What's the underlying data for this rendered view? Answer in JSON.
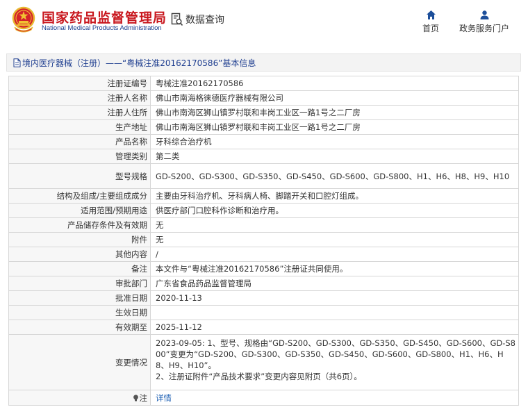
{
  "header": {
    "brand_cn": "国家药品监督管理局",
    "brand_en": "National Medical Products Administration",
    "query_label": "数据查询",
    "nav": [
      {
        "label": "首页",
        "icon": "home-icon"
      },
      {
        "label": "政务服务门户",
        "icon": "user-icon"
      }
    ]
  },
  "title_bar": {
    "text": "境内医疗器械（注册）——“粤械注准20162170586”基本信息"
  },
  "fields": [
    {
      "label": "注册证编号",
      "value": "粤械注准20162170586"
    },
    {
      "label": "注册人名称",
      "value": "佛山市南海格徕德医疗器械有限公司"
    },
    {
      "label": "注册人住所",
      "value": "佛山市南海区狮山镇罗村联和丰岗工业区一路1号之二厂房"
    },
    {
      "label": "生产地址",
      "value": "佛山市南海区狮山镇罗村联和丰岗工业区一路1号之二厂房"
    },
    {
      "label": "产品名称",
      "value": "牙科综合治疗机"
    },
    {
      "label": "管理类别",
      "value": "第二类"
    },
    {
      "label": "型号规格",
      "value": "GD-S200、GD-S300、GD-S350、GD-S450、GD-S600、GD-S800、H1、H6、H8、H9、H10"
    },
    {
      "label": "结构及组成/主要组成成分",
      "value": "主要由牙科治疗机、牙科病人椅、脚踏开关和口腔灯组成。"
    },
    {
      "label": "适用范围/预期用途",
      "value": "供医疗部门口腔科作诊断和治疗用。"
    },
    {
      "label": "产品储存条件及有效期",
      "value": "无"
    },
    {
      "label": "附件",
      "value": "无"
    },
    {
      "label": "其他内容",
      "value": "/"
    },
    {
      "label": "备注",
      "value": "本文件与“粤械注准20162170586”注册证共同使用。"
    },
    {
      "label": "审批部门",
      "value": "广东省食品药品监督管理局"
    },
    {
      "label": "批准日期",
      "value": "2020-11-13"
    },
    {
      "label": "生效日期",
      "value": ""
    },
    {
      "label": "有效期至",
      "value": "2025-11-12"
    }
  ],
  "changes": {
    "label": "变更情况",
    "line1": "2023-09-05: 1、型号、规格由“GD-S200、GD-S300、GD-S350、GD-S450、GD-S600、GD-S800”变更为“GD-S200、GD-S300、GD-S350、GD-S450、GD-S600、GD-S800、H1、H6、H8、H9、H10”。",
    "line2": "2、注册证附件“产品技术要求”变更内容见附页（共6页）。"
  },
  "note": {
    "label": "注",
    "link": "详情",
    "icon": "bulb-icon"
  },
  "colors": {
    "brand_red": "#c8161d",
    "brand_blue": "#1b3f8f",
    "link_blue": "#1d5fb3"
  }
}
